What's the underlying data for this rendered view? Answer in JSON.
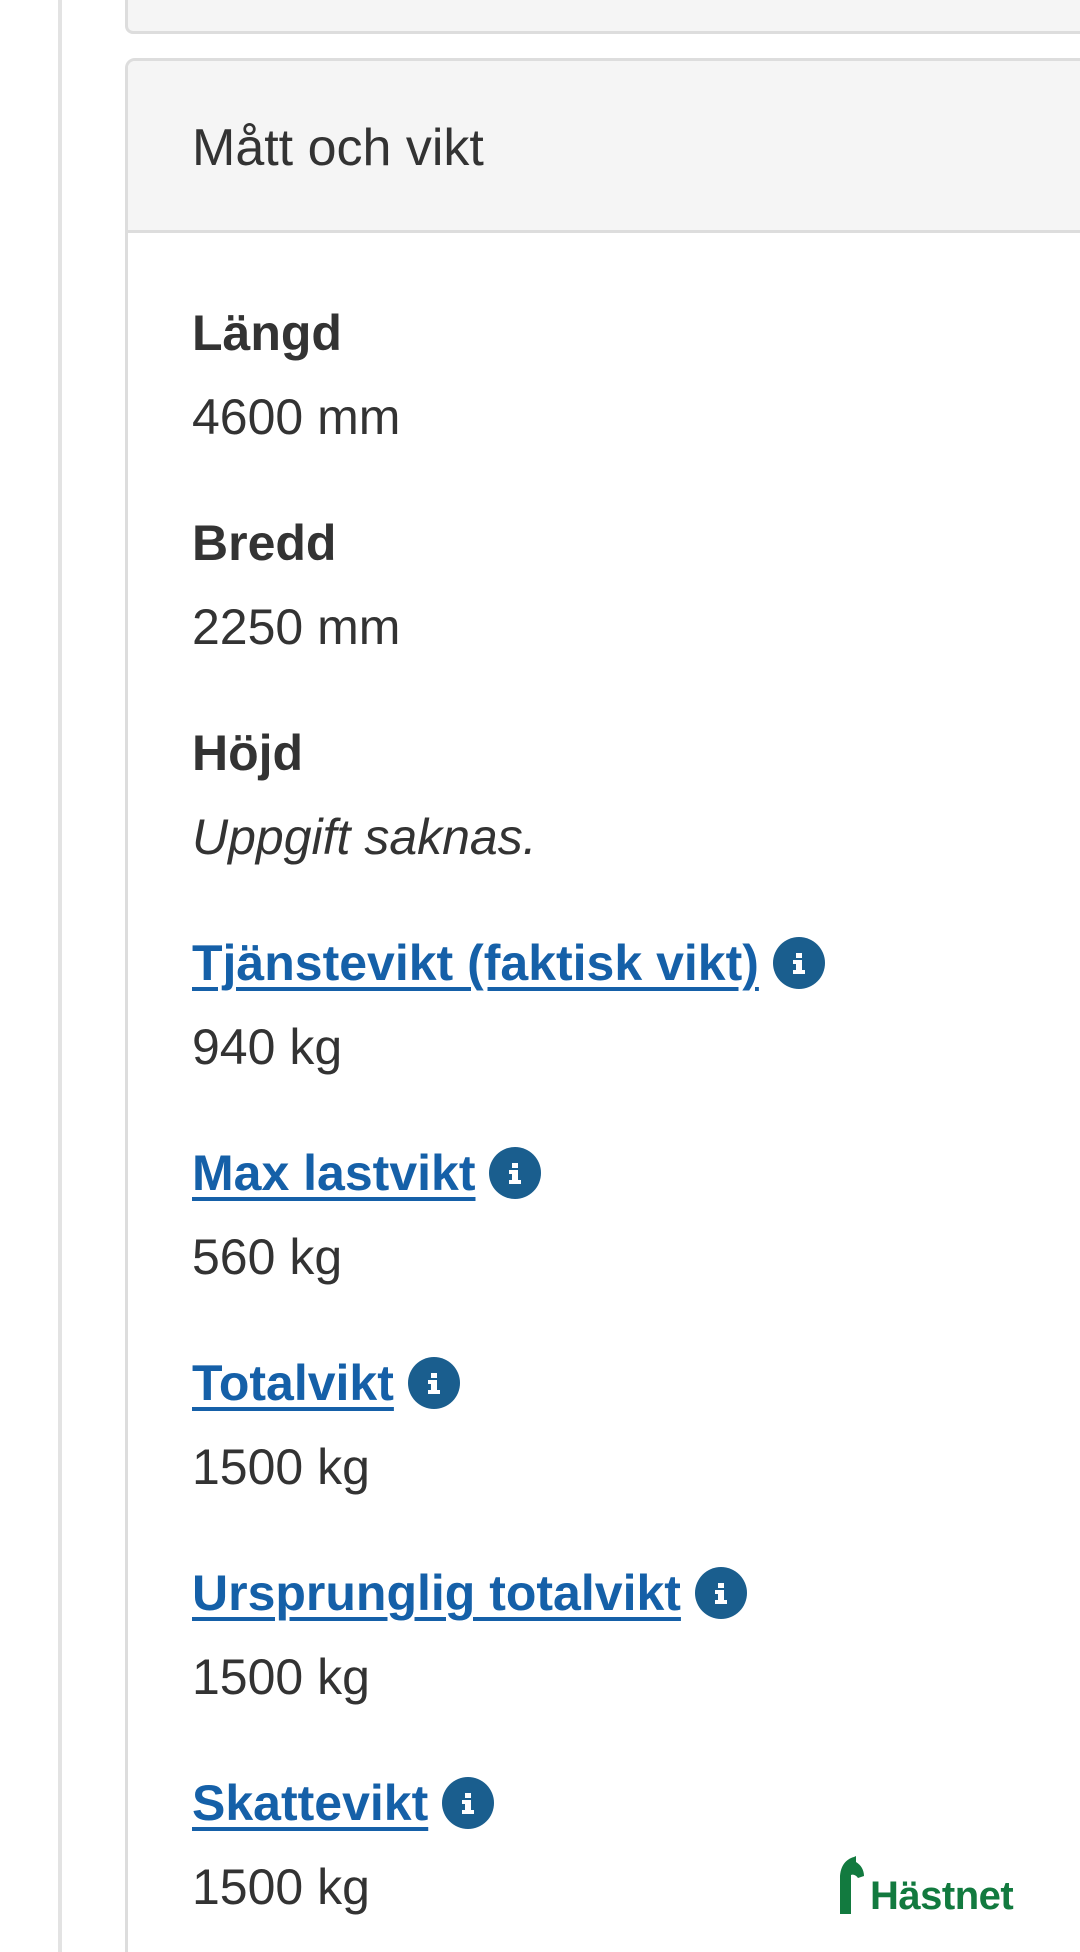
{
  "card": {
    "title": "Mått och vikt"
  },
  "fields": [
    {
      "label": "Längd",
      "value": "4600 mm",
      "link": false,
      "info": false,
      "missing": false
    },
    {
      "label": "Bredd",
      "value": "2250 mm",
      "link": false,
      "info": false,
      "missing": false
    },
    {
      "label": "Höjd",
      "value": "Uppgift saknas.",
      "link": false,
      "info": false,
      "missing": true
    },
    {
      "label": "Tjänstevikt (faktisk vikt) ",
      "value": "940 kg",
      "link": true,
      "info": true,
      "missing": false
    },
    {
      "label": "Max lastvikt ",
      "value": "560 kg",
      "link": true,
      "info": true,
      "missing": false
    },
    {
      "label": "Totalvikt ",
      "value": "1500 kg",
      "link": true,
      "info": true,
      "missing": false
    },
    {
      "label": "Ursprunglig totalvikt ",
      "value": "1500 kg",
      "link": true,
      "info": true,
      "missing": false
    },
    {
      "label": "Skattevikt ",
      "value": "1500 kg",
      "link": true,
      "info": true,
      "missing": false
    }
  ],
  "logo": {
    "text": "Hästnet"
  },
  "colors": {
    "link": "#1560a8",
    "info_icon": "#1a5e8e",
    "logo": "#127a3f",
    "header_bg": "#f5f5f5",
    "border": "#dddddd"
  },
  "icons": {
    "info": "info-circle-icon",
    "logo": "horse-head-icon"
  }
}
